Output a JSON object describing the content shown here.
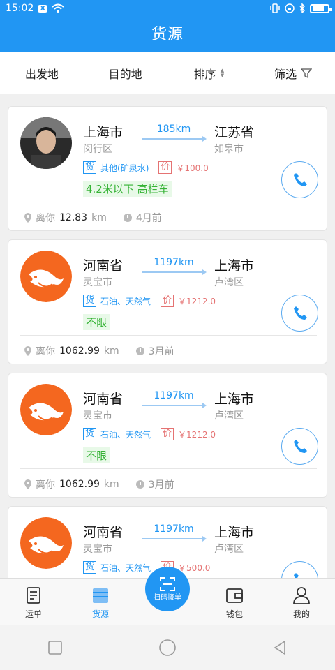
{
  "status_bar": {
    "time": "15:02",
    "notif": "X"
  },
  "header": {
    "title": "货源"
  },
  "filters": [
    {
      "label": "出发地"
    },
    {
      "label": "目的地"
    },
    {
      "label": "排序"
    },
    {
      "label": "筛选"
    }
  ],
  "cards": [
    {
      "avatar": "user-photo",
      "from_city": "上海市",
      "from_district": "闵行区",
      "distance": "185km",
      "to_city": "江苏省",
      "to_district": "如皋市",
      "goods_tag": "货",
      "goods": "其他(矿泉水)",
      "price_tag": "价",
      "price": "￥100.0",
      "spec": "4.2米以下 高栏车",
      "away_label": "离你",
      "away_value": "12.83",
      "away_unit": "km",
      "time_ago": "4月前"
    },
    {
      "avatar": "fish-logo",
      "from_city": "河南省",
      "from_district": "灵宝市",
      "distance": "1197km",
      "to_city": "上海市",
      "to_district": "卢湾区",
      "goods_tag": "货",
      "goods": "石油、天然气",
      "price_tag": "价",
      "price": "￥1212.0",
      "spec": "不限",
      "away_label": "离你",
      "away_value": "1062.99",
      "away_unit": "km",
      "time_ago": "3月前"
    },
    {
      "avatar": "fish-logo",
      "from_city": "河南省",
      "from_district": "灵宝市",
      "distance": "1197km",
      "to_city": "上海市",
      "to_district": "卢湾区",
      "goods_tag": "货",
      "goods": "石油、天然气",
      "price_tag": "价",
      "price": "￥1212.0",
      "spec": "不限",
      "away_label": "离你",
      "away_value": "1062.99",
      "away_unit": "km",
      "time_ago": "3月前"
    },
    {
      "avatar": "fish-logo",
      "from_city": "河南省",
      "from_district": "灵宝市",
      "distance": "1197km",
      "to_city": "上海市",
      "to_district": "卢湾区",
      "goods_tag": "货",
      "goods": "石油、天然气",
      "price_tag": "价",
      "price": "￥500.0",
      "spec": "",
      "away_label": "",
      "away_value": "",
      "away_unit": "",
      "time_ago": ""
    }
  ],
  "tabs": [
    {
      "label": "运单",
      "icon": "waybill-icon",
      "active": false
    },
    {
      "label": "货源",
      "icon": "cargo-icon",
      "active": true
    },
    {
      "label": "扫码接单",
      "icon": "scan-icon",
      "active": false
    },
    {
      "label": "钱包",
      "icon": "wallet-icon",
      "active": false
    },
    {
      "label": "我的",
      "icon": "profile-icon",
      "active": false
    }
  ],
  "colors": {
    "primary": "#2196f3",
    "price": "#e57373",
    "spec": "#36b336"
  }
}
